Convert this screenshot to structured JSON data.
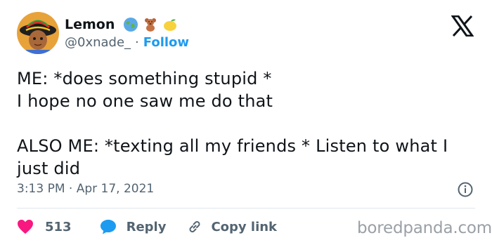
{
  "author": {
    "name": "Lemon",
    "handle": "@0xnade_",
    "separator": "·",
    "follow_label": "Follow",
    "name_emojis": [
      "globe-emoji",
      "teddy-bear-emoji",
      "lemon-emoji"
    ]
  },
  "tweet": {
    "line1": "ME: *does something stupid *",
    "line2": "I hope no one saw me do that",
    "line3": "ALSO ME: *texting all my friends * Listen to what I just did",
    "timestamp": "3:13 PM · Apr 17, 2021"
  },
  "actions": {
    "likes_count": "513",
    "reply_label": "Reply",
    "copy_link_label": "Copy link"
  },
  "watermark": "boredpanda.com",
  "colors": {
    "like": "#f91880",
    "reply": "#1d9bf0",
    "link": "#1d9bf0",
    "secondary_text": "#536471",
    "divider": "#e1e6ea"
  }
}
